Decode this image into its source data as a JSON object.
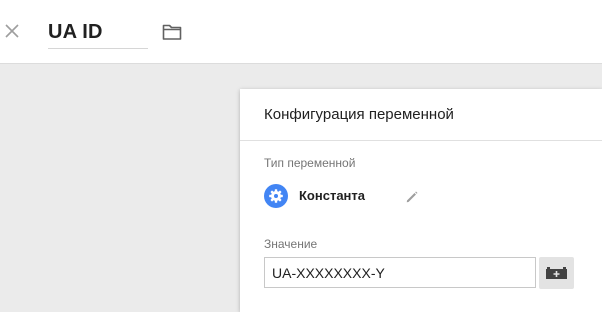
{
  "header": {
    "variable_name": "UA ID",
    "close_icon": "close-icon",
    "folder_icon": "folder-icon"
  },
  "panel": {
    "title": "Конфигурация переменной",
    "type_label": "Тип переменной",
    "type_name": "Константа",
    "type_icon": "gear-icon",
    "type_icon_color": "#4285f4",
    "edit_icon": "pencil-icon",
    "value_label": "Значение",
    "value": "UA-XXXXXXXX-Y",
    "variable_picker_icon": "add-variable-icon"
  }
}
